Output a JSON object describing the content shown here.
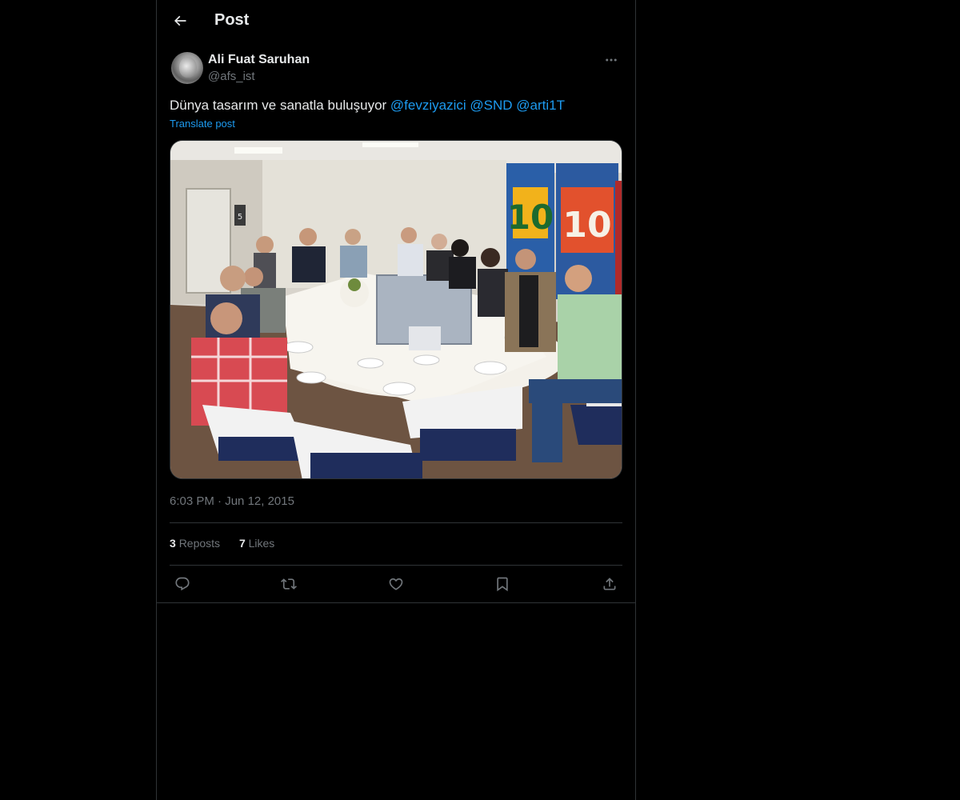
{
  "header": {
    "title": "Post",
    "back_icon": "arrow-left-icon"
  },
  "post": {
    "author": {
      "display_name": "Ali Fuat Saruhan",
      "handle": "@afs_ist",
      "avatar": "avatar-photo"
    },
    "more_icon": "more-horizontal-icon",
    "text_prefix": "Dünya tasarım ve sanatla buluşuyor ",
    "mentions": [
      "@fevziyazici",
      "@SND",
      "@arti1T"
    ],
    "translate_label": "Translate post",
    "media": {
      "description_icon": "photo",
      "jersey_number_1": "10",
      "jersey_number_2": "10",
      "door_sign": "5"
    },
    "time": "6:03 PM",
    "separator": "·",
    "date": "Jun 12, 2015",
    "stats": {
      "reposts_count": "3",
      "reposts_label": "Reposts",
      "likes_count": "7",
      "likes_label": "Likes"
    },
    "actions": [
      "reply-icon",
      "repost-icon",
      "like-icon",
      "bookmark-icon",
      "share-icon"
    ]
  },
  "colors": {
    "background": "#000000",
    "text_primary": "#e7e9ea",
    "text_secondary": "#71767b",
    "accent": "#1d9bf0",
    "border": "#2f3336"
  }
}
